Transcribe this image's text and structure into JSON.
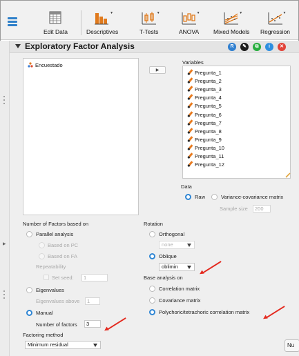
{
  "toolbar": {
    "items": [
      {
        "label": "Edit Data",
        "icon": "spreadsheet-icon"
      },
      {
        "label": "Descriptives",
        "icon": "bar-chart-icon"
      },
      {
        "label": "T-Tests",
        "icon": "ttest-icon"
      },
      {
        "label": "ANOVA",
        "icon": "anova-icon"
      },
      {
        "label": "Mixed Models",
        "icon": "mixed-models-icon"
      },
      {
        "label": "Regression",
        "icon": "regression-icon"
      }
    ]
  },
  "analysis": {
    "title": "Exploratory Factor Analysis",
    "header_icons": [
      {
        "name": "r-icon",
        "glyph": "R",
        "color": "#2f7fd0"
      },
      {
        "name": "edit-icon",
        "glyph": "✎",
        "color": "#1d1d1d"
      },
      {
        "name": "copy-icon",
        "glyph": "⧉",
        "color": "#27ae3e"
      },
      {
        "name": "info-icon",
        "glyph": "i",
        "color": "#2f8fe0"
      },
      {
        "name": "close-icon",
        "glyph": "✕",
        "color": "#e2443a"
      }
    ]
  },
  "source": {
    "items": [
      "Encuestado"
    ]
  },
  "variables": {
    "heading": "Variables",
    "items": [
      "Pregunta_1",
      "Pregunta_2",
      "Pregunta_3",
      "Pregunta_4",
      "Pregunta_5",
      "Pregunta_6",
      "Pregunta_7",
      "Pregunta_8",
      "Pregunta_9",
      "Pregunta_10",
      "Pregunta_11",
      "Pregunta_12"
    ]
  },
  "data_section": {
    "heading": "Data",
    "raw": "Raw",
    "cov": "Variance-covariance matrix",
    "sample_size_label": "Sample size",
    "sample_size_value": "200",
    "selected": "Raw"
  },
  "factors": {
    "heading": "Number of Factors based on",
    "parallel": "Parallel analysis",
    "based_on_pc": "Based on PC",
    "based_on_fa": "Based on FA",
    "repeatability": "Repeatability",
    "set_seed": "Set seed:",
    "seed_value": "1",
    "eigenvalues": "Eigenvalues",
    "eigen_above": "Eigenvalues above",
    "eigen_value": "1",
    "manual": "Manual",
    "num_factors_label": "Number of factors",
    "num_factors_value": "3",
    "selected": "Manual"
  },
  "factoring": {
    "heading": "Factoring method",
    "value": "Minimum residual"
  },
  "rotation": {
    "heading": "Rotation",
    "orthogonal": "Orthogonal",
    "orthogonal_value": "none",
    "oblique": "Oblique",
    "oblique_value": "oblimin",
    "selected": "Oblique"
  },
  "base": {
    "heading": "Base analysis on",
    "correlation": "Correlation matrix",
    "covariance": "Covariance matrix",
    "polychoric": "Polychoric/tetrachoric correlation matrix",
    "selected": "Polychoric/tetrachoric correlation matrix"
  },
  "cut_button": "Nu",
  "colors": {
    "accent": "#2f86d4",
    "annotation_arrow": "#e42a1f",
    "pencil_orange": "#e87b1f"
  }
}
